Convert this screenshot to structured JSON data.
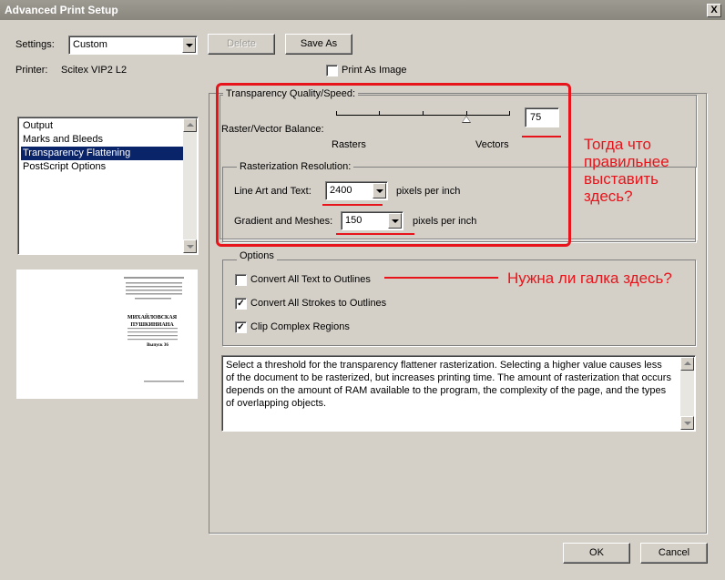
{
  "window": {
    "title": "Advanced Print Setup",
    "close_label": "X"
  },
  "settings": {
    "label": "Settings:",
    "value": "Custom",
    "delete_label": "Delete",
    "saveas_label": "Save As"
  },
  "printer": {
    "label": "Printer:",
    "value": "Scitex VIP2 L2"
  },
  "print_as_image": {
    "label": "Print As Image",
    "checked": false
  },
  "nav_list": {
    "items": [
      "Output",
      "Marks and Bleeds",
      "Transparency Flattening",
      "PostScript Options"
    ],
    "selected": "Transparency Flattening"
  },
  "preview": {
    "lines": [
      "МИХАЙЛОВСКАЯ",
      "ПУШКИНИАНА"
    ],
    "issue": "Выпуск 36"
  },
  "transparency": {
    "group_label": "Transparency Quality/Speed:",
    "balance_label": "Raster/Vector Balance:",
    "balance_value": "75",
    "rasters_label": "Rasters",
    "vectors_label": "Vectors"
  },
  "rasterization": {
    "group_label": "Rasterization Resolution:",
    "line_art_label": "Line Art and Text:",
    "line_art_value": "2400",
    "line_art_unit": "pixels per inch",
    "gradient_label": "Gradient and Meshes:",
    "gradient_value": "150",
    "gradient_unit": "pixels per inch"
  },
  "options": {
    "group_label": "Options",
    "items": [
      {
        "label": "Convert All Text to Outlines",
        "checked": false
      },
      {
        "label": "Convert All Strokes to Outlines",
        "checked": true
      },
      {
        "label": "Clip Complex Regions",
        "checked": true
      }
    ]
  },
  "description": "Select a threshold for the transparency flattener rasterization. Selecting a higher value causes less of the document to be rasterized, but increases printing time. The amount of rasterization that occurs depends on the amount of RAM available to the program, the complexity of the page, and the types of overlapping objects.",
  "footer": {
    "ok_label": "OK",
    "cancel_label": "Cancel"
  },
  "annotations": {
    "question1": "Тогда что правильнее выставить здесь?",
    "question2": "Нужна ли галка здесь?",
    "color": "#e8141b"
  }
}
